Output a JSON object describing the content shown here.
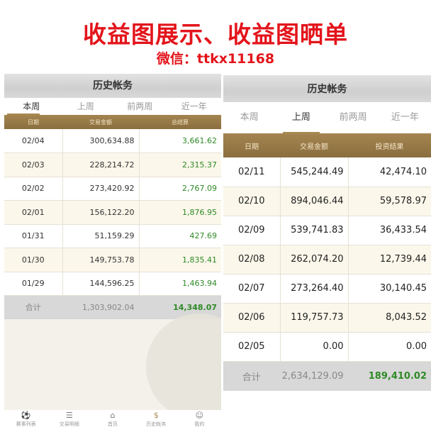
{
  "banner": {
    "title": "收益图展示、收益图晒单",
    "contact": "微信：ttkx11168"
  },
  "colors": {
    "banner_red": "#e3141b",
    "accent_gold": "#a88a53",
    "profit_green": "#2f8a26"
  },
  "left": {
    "header_title": "历史帐务",
    "tabs": [
      {
        "label": "本周",
        "active": true
      },
      {
        "label": "上周",
        "active": false
      },
      {
        "label": "前两周",
        "active": false
      },
      {
        "label": "近一年",
        "active": false
      }
    ],
    "columns": [
      "日期",
      "交易金额",
      "总结算"
    ],
    "rows": [
      {
        "date": "02/04",
        "amount": "300,634.88",
        "result": "3,661.62"
      },
      {
        "date": "02/03",
        "amount": "228,214.72",
        "result": "2,315.37"
      },
      {
        "date": "02/02",
        "amount": "273,420.92",
        "result": "2,767.09"
      },
      {
        "date": "02/01",
        "amount": "156,122.20",
        "result": "1,876.95"
      },
      {
        "date": "01/31",
        "amount": "51,159.29",
        "result": "427.69"
      },
      {
        "date": "01/30",
        "amount": "149,753.78",
        "result": "1,835.41"
      },
      {
        "date": "01/29",
        "amount": "144,596.25",
        "result": "1,463.94"
      }
    ],
    "total": {
      "label": "合计",
      "amount": "1,303,902.04",
      "result": "14,348.07"
    },
    "nav": [
      {
        "icon": "soccer-ball-icon",
        "glyph": "⚽",
        "label": "赛事列表"
      },
      {
        "icon": "list-icon",
        "glyph": "☰",
        "label": "交易明细"
      },
      {
        "icon": "home-icon",
        "glyph": "⌂",
        "label": "首页"
      },
      {
        "icon": "dollar-icon",
        "glyph": "$",
        "label": "历史帐务",
        "active": true
      },
      {
        "icon": "user-icon",
        "glyph": "☺",
        "label": "我的"
      }
    ]
  },
  "right": {
    "header_title": "历史帐务",
    "tabs": [
      {
        "label": "本周",
        "active": false
      },
      {
        "label": "上周",
        "active": true
      },
      {
        "label": "前两周",
        "active": false
      },
      {
        "label": "近一年",
        "active": false
      }
    ],
    "columns": [
      "日期",
      "交易金额",
      "投资结果"
    ],
    "rows": [
      {
        "date": "02/11",
        "amount": "545,244.49",
        "result": "42,474.10"
      },
      {
        "date": "02/10",
        "amount": "894,046.44",
        "result": "59,578.97"
      },
      {
        "date": "02/09",
        "amount": "539,741.83",
        "result": "36,433.54"
      },
      {
        "date": "02/08",
        "amount": "262,074.20",
        "result": "12,739.44"
      },
      {
        "date": "02/07",
        "amount": "273,264.40",
        "result": "30,140.45"
      },
      {
        "date": "02/06",
        "amount": "119,757.73",
        "result": "8,043.52"
      },
      {
        "date": "02/05",
        "amount": "0.00",
        "result": "0.00"
      }
    ],
    "total": {
      "label": "合计",
      "amount": "2,634,129.09",
      "result": "189,410.02"
    }
  }
}
